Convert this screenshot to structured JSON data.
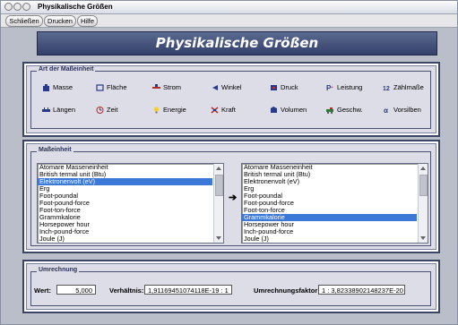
{
  "window": {
    "title": "Physikalische Größen"
  },
  "menu": [
    {
      "label": "Schließen"
    },
    {
      "label": "Drucken"
    },
    {
      "label": "Hilfe"
    }
  ],
  "header": {
    "title": "Physikalische Größen"
  },
  "unit_type": {
    "group_title": "Art der Maßeinheit",
    "categories": [
      {
        "label": "Masse",
        "icon": "weight-icon"
      },
      {
        "label": "Fläche",
        "icon": "area-icon"
      },
      {
        "label": "Strom",
        "icon": "current-icon"
      },
      {
        "label": "Winkel",
        "icon": "angle-icon"
      },
      {
        "label": "Druck",
        "icon": "pressure-icon"
      },
      {
        "label": "Leistung",
        "icon": "power-icon"
      },
      {
        "label": "Zählmaße",
        "icon": "count-icon"
      },
      {
        "label": "Längen",
        "icon": "ruler-icon"
      },
      {
        "label": "Zeit",
        "icon": "clock-icon"
      },
      {
        "label": "Energie",
        "icon": "bulb-icon"
      },
      {
        "label": "Kraft",
        "icon": "force-icon"
      },
      {
        "label": "Volumen",
        "icon": "volume-icon"
      },
      {
        "label": "Geschw.",
        "icon": "speed-icon"
      },
      {
        "label": "Vorsilben",
        "icon": "prefix-icon"
      }
    ]
  },
  "unit": {
    "group_title": "Maßeinheit",
    "list_left": {
      "items": [
        "Atomare Masseneinheit",
        "British termal unit (Btu)",
        "Elektronenvolt (eV)",
        "Erg",
        "Foot-poundal",
        "Foot-pound-force",
        "Foot-ton-force",
        "Grammkalorie",
        "Horsepower hour",
        "Inch-pound-force",
        "Joule (J)"
      ],
      "selected_index": 2
    },
    "list_right": {
      "items": [
        "Atomare Masseneinheit",
        "British termal unit (Btu)",
        "Elektronenvolt (eV)",
        "Erg",
        "Foot-poundal",
        "Foot-pound-force",
        "Foot-ton-force",
        "Grammkalorie",
        "Horsepower hour",
        "Inch-pound-force",
        "Joule (J)"
      ],
      "selected_index": 7
    }
  },
  "conversion": {
    "group_title": "Umrechnung",
    "value_label": "Wert:",
    "value": "5,000",
    "ratio_label": "Verhältnis:",
    "ratio": "1,91169451074118E-19 : 1",
    "factor_label": "Umrechnungsfaktor:",
    "factor": "1 : 3,82338902148237E-20"
  },
  "colors": {
    "header_bg": "#3f4b75",
    "selection": "#3c78d8"
  }
}
